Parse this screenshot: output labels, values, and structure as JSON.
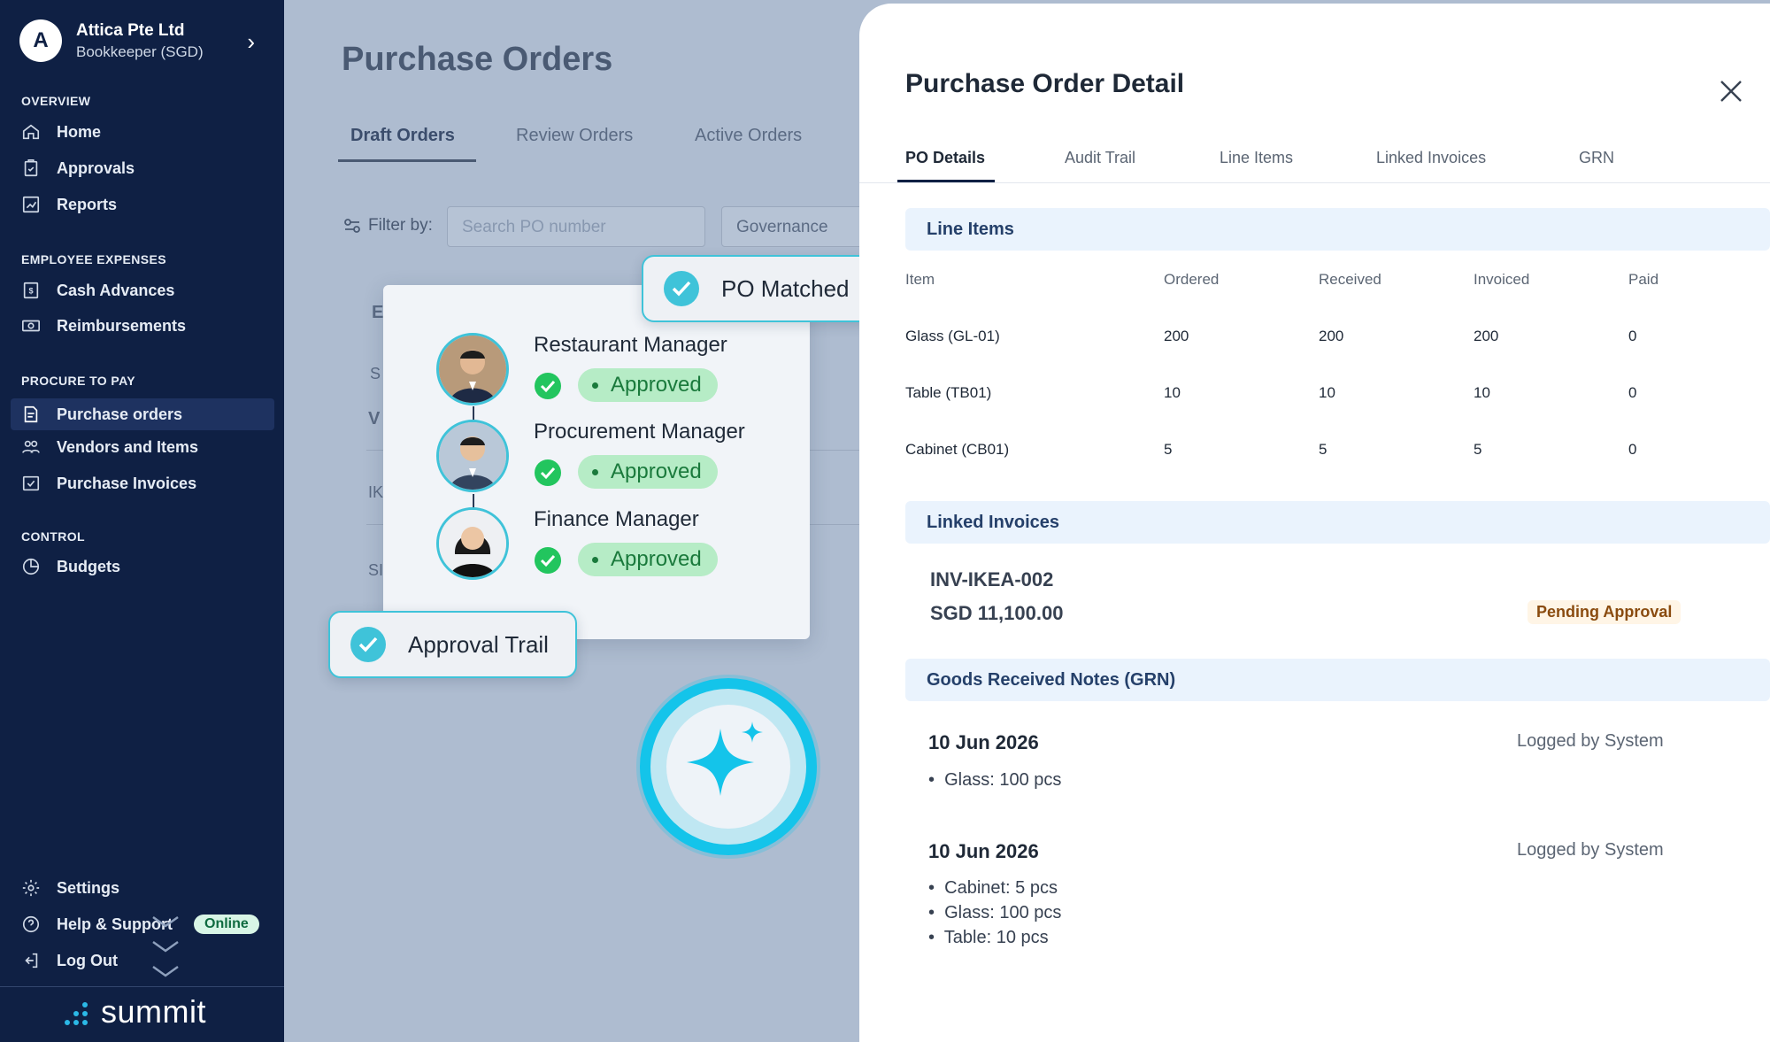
{
  "sidebar": {
    "org": {
      "initial": "A",
      "name": "Attica Pte Ltd",
      "role": "Bookkeeper (SGD)"
    },
    "sections": {
      "overview": "OVERVIEW",
      "employee_expenses": "EMPLOYEE EXPENSES",
      "procure_to_pay": "PROCURE TO PAY",
      "control": "CONTROL"
    },
    "items": {
      "home": "Home",
      "approvals": "Approvals",
      "reports": "Reports",
      "cash_advances": "Cash Advances",
      "reimbursements": "Reimbursements",
      "purchase_orders": "Purchase orders",
      "vendors_items": "Vendors and Items",
      "purchase_invoices": "Purchase Invoices",
      "budgets": "Budgets",
      "settings": "Settings",
      "help": "Help & Support",
      "logout": "Log Out"
    },
    "online_badge": "Online",
    "brand": "summit"
  },
  "main": {
    "title": "Purchase Orders",
    "tabs": [
      "Draft Orders",
      "Review Orders",
      "Active Orders"
    ],
    "filter_label": "Filter by:",
    "search_placeholder": "Search PO number",
    "governance": "Governance",
    "bg_fragments": [
      "E",
      "S",
      "V",
      "IK",
      "SI"
    ]
  },
  "approval_card": {
    "approvers": [
      {
        "role": "Restaurant Manager",
        "status": "Approved"
      },
      {
        "role": "Procurement Manager",
        "status": "Approved"
      },
      {
        "role": "Finance Manager",
        "status": "Approved"
      }
    ]
  },
  "chips": {
    "po_matched": "PO Matched",
    "approval_trail": "Approval Trail"
  },
  "detail": {
    "title": "Purchase Order Detail",
    "tabs": [
      "PO Details",
      "Audit Trail",
      "Line Items",
      "Linked Invoices",
      "GRN"
    ],
    "line_items": {
      "heading": "Line Items",
      "columns": [
        "Item",
        "Ordered",
        "Received",
        "Invoiced",
        "Paid"
      ],
      "rows": [
        {
          "item": "Glass (GL-01)",
          "ordered": "200",
          "received": "200",
          "invoiced": "200",
          "paid": "0"
        },
        {
          "item": "Table (TB01)",
          "ordered": "10",
          "received": "10",
          "invoiced": "10",
          "paid": "0"
        },
        {
          "item": "Cabinet (CB01)",
          "ordered": "5",
          "received": "5",
          "invoiced": "5",
          "paid": "0"
        }
      ]
    },
    "linked_invoices": {
      "heading": "Linked Invoices",
      "invoice_id": "INV-IKEA-002",
      "amount": "SGD 11,100.00",
      "status": "Pending Approval"
    },
    "grn": {
      "heading": "Goods Received Notes (GRN)",
      "notes": [
        {
          "date": "10 Jun 2026",
          "logged_by": "Logged by System",
          "items": [
            "Glass: 100 pcs"
          ]
        },
        {
          "date": "10 Jun 2026",
          "logged_by": "Logged by System",
          "items": [
            "Cabinet: 5 pcs",
            "Glass: 100 pcs",
            "Table: 10 pcs"
          ]
        }
      ]
    }
  },
  "colors": {
    "sidebar_bg": "#0f2044",
    "accent_cyan": "#3fc3d9",
    "approved_green": "#22c55e",
    "overlay_bg": "#aebcd0"
  }
}
